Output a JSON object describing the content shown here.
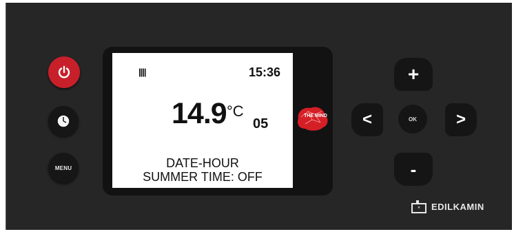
{
  "controls": {
    "power": "power-icon",
    "clock": "clock-icon",
    "menu_label": "MENU",
    "plus_label": "+",
    "minus_label": "-",
    "left_label": "<",
    "right_label": ">",
    "ok_label": "OK"
  },
  "display": {
    "time": "15:36",
    "temperature": "14.9",
    "unit": "°C",
    "level": "05",
    "line1": "DATE-HOUR",
    "line2": "SUMMER TIME: OFF"
  },
  "branding": {
    "mind_logo_text": "THE MIND",
    "brand_name": "EDILKAMIN"
  },
  "colors": {
    "panel": "#262626",
    "power_button": "#c8202a",
    "mind_logo": "#d51f26",
    "screen": "#ffffff"
  }
}
